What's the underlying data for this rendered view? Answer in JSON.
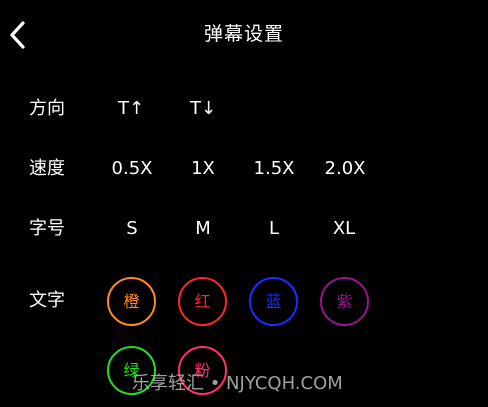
{
  "header": {
    "title": "弹幕设置",
    "back_icon": "chevron-left-icon"
  },
  "direction": {
    "label": "方向",
    "options": [
      "T↑",
      "T↓"
    ]
  },
  "speed": {
    "label": "速度",
    "options": [
      "0.5X",
      "1X",
      "1.5X",
      "2.0X"
    ]
  },
  "font_size": {
    "label": "字号",
    "options": [
      "S",
      "M",
      "L",
      "XL"
    ]
  },
  "text_color": {
    "label": "文字",
    "swatches": [
      {
        "label": "橙",
        "color": "#ff8a1f"
      },
      {
        "label": "红",
        "color": "#ff2525"
      },
      {
        "label": "蓝",
        "color": "#1f2bff"
      },
      {
        "label": "紫",
        "color": "#9a138f"
      },
      {
        "label": "绿",
        "color": "#22dd22"
      },
      {
        "label": "粉",
        "color": "#ff2f6a"
      }
    ]
  },
  "watermark": "乐享轻汇 • NJYCQH.COM"
}
